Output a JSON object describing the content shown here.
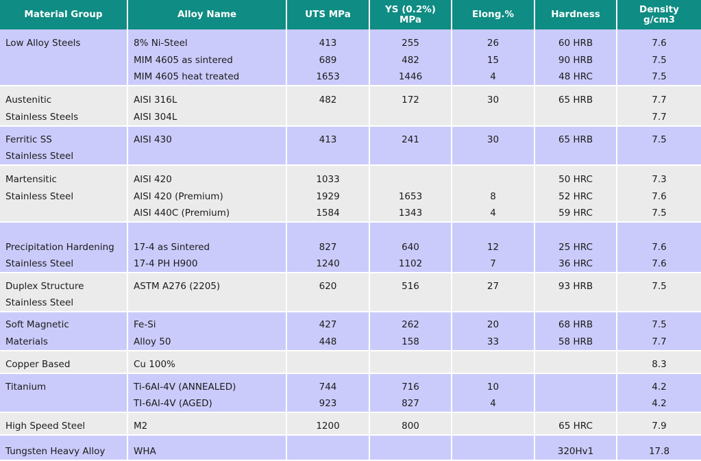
{
  "headers": {
    "group": "Material Group",
    "alloy": "Alloy Name",
    "uts": "UTS MPa",
    "ys_line1": "YS (0.2%)",
    "ys_line2": "MPa",
    "elong": "Elong.%",
    "hardness": "Hardness",
    "density_line1": "Density",
    "density_line2": "g/cm3"
  },
  "groups": [
    {
      "group": [
        "Low Alloy Steels",
        "",
        ""
      ],
      "alloy": [
        "8% Ni-Steel",
        "MIM 4605 as sintered",
        "MIM 4605 heat treated"
      ],
      "uts": [
        "413",
        "689",
        "1653"
      ],
      "ys": [
        "255",
        "482",
        "1446"
      ],
      "elong": [
        "26",
        "15",
        "4"
      ],
      "hardness": [
        "60 HRB",
        "90 HRB",
        "48 HRC"
      ],
      "density": [
        "7.6",
        "7.5",
        "7.5"
      ]
    },
    {
      "group": [
        "Austenitic",
        "Stainless Steels"
      ],
      "alloy": [
        "AISI 316L",
        "AISI 304L"
      ],
      "uts": [
        "482",
        ""
      ],
      "ys": [
        "172",
        ""
      ],
      "elong": [
        "30",
        ""
      ],
      "hardness": [
        "65 HRB",
        ""
      ],
      "density": [
        "7.7",
        "7.7"
      ]
    },
    {
      "group": [
        "Ferritic SS",
        "Stainless Steel"
      ],
      "alloy": [
        "AISI 430",
        ""
      ],
      "uts": [
        "413",
        ""
      ],
      "ys": [
        "241",
        ""
      ],
      "elong": [
        "30",
        ""
      ],
      "hardness": [
        "65 HRB",
        ""
      ],
      "density": [
        "7.5",
        ""
      ]
    },
    {
      "group": [
        "Martensitic",
        "Stainless Steel",
        ""
      ],
      "alloy": [
        "AISI 420",
        "AISI 420 (Premium)",
        "AISI 440C (Premium)"
      ],
      "uts": [
        "1033",
        "1929",
        "1584"
      ],
      "ys": [
        "",
        "1653",
        "1343"
      ],
      "elong": [
        "",
        "8",
        "4"
      ],
      "hardness": [
        "50 HRC",
        "52 HRC",
        "59 HRC"
      ],
      "density": [
        "7.3",
        "7.6",
        "7.5"
      ]
    },
    {
      "group": [
        "Precipitation Hardening",
        "Stainless Steel"
      ],
      "alloy": [
        "17-4 as Sintered",
        "17-4 PH H900"
      ],
      "uts": [
        "827",
        "1240"
      ],
      "ys": [
        "640",
        "1102"
      ],
      "elong": [
        "12",
        "7"
      ],
      "hardness": [
        "25 HRC",
        "36 HRC"
      ],
      "density": [
        "7.6",
        "7.6"
      ]
    },
    {
      "group": [
        "Duplex Structure",
        "Stainless Steel"
      ],
      "alloy": [
        "ASTM A276 (2205)",
        ""
      ],
      "uts": [
        "620",
        ""
      ],
      "ys": [
        "516",
        ""
      ],
      "elong": [
        "27",
        ""
      ],
      "hardness": [
        "93 HRB",
        ""
      ],
      "density": [
        "7.5",
        ""
      ]
    },
    {
      "group": [
        "Soft Magnetic",
        "Materials"
      ],
      "alloy": [
        "Fe-Si",
        "Alloy 50"
      ],
      "uts": [
        "427",
        "448"
      ],
      "ys": [
        "262",
        "158"
      ],
      "elong": [
        "20",
        "33"
      ],
      "hardness": [
        "68 HRB",
        "58 HRB"
      ],
      "density": [
        "7.5",
        "7.7"
      ]
    },
    {
      "group": [
        "Copper Based"
      ],
      "alloy": [
        "Cu 100%"
      ],
      "uts": [
        ""
      ],
      "ys": [
        ""
      ],
      "elong": [
        ""
      ],
      "hardness": [
        ""
      ],
      "density": [
        "8.3"
      ]
    },
    {
      "group": [
        "Titanium",
        ""
      ],
      "alloy": [
        "Ti-6AI-4V (ANNEALED)",
        "TI-6AI-4V (AGED)"
      ],
      "uts": [
        "744",
        "923"
      ],
      "ys": [
        "716",
        "827"
      ],
      "elong": [
        "10",
        "4"
      ],
      "hardness": [
        "",
        ""
      ],
      "density": [
        "4.2",
        "4.2"
      ]
    },
    {
      "group": [
        "High Speed Steel"
      ],
      "alloy": [
        "M2"
      ],
      "uts": [
        "1200"
      ],
      "ys": [
        "800"
      ],
      "elong": [
        ""
      ],
      "hardness": [
        "65 HRC"
      ],
      "density": [
        "7.9"
      ]
    },
    {
      "group": [
        "Tungsten Heavy Alloy"
      ],
      "alloy": [
        "WHA"
      ],
      "uts": [
        ""
      ],
      "ys": [
        ""
      ],
      "elong": [
        ""
      ],
      "hardness": [
        "320Hv1"
      ],
      "density": [
        "17.8"
      ]
    }
  ]
}
